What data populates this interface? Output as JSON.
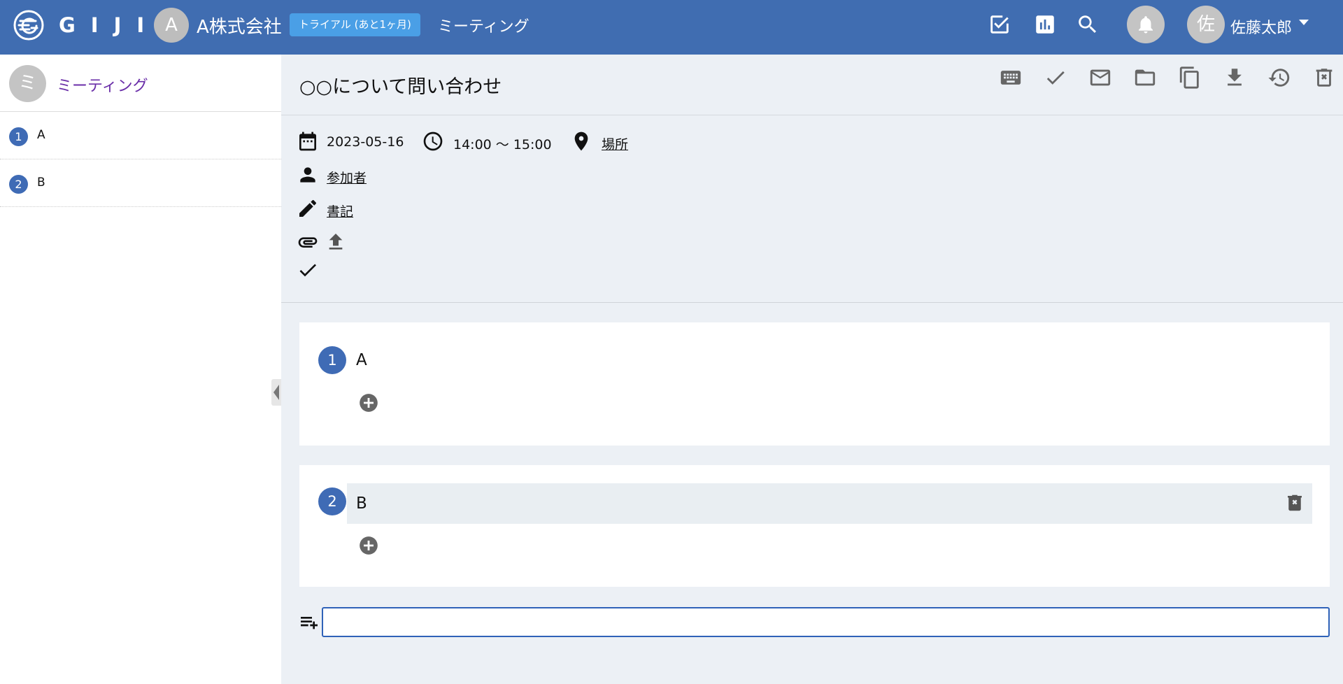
{
  "header": {
    "logo_text": "GIJI",
    "org_avatar": "A",
    "org_name": "A株式会社",
    "trial_badge": "トライアル (あと1ヶ月)",
    "section_title": "ミーティング",
    "user_avatar": "佐",
    "user_name": "佐藤太郎",
    "icons": [
      "task-check-icon",
      "chart-icon",
      "search-icon",
      "bell-icon",
      "caret-down-icon"
    ],
    "brand_color": "#406db1"
  },
  "sidebar": {
    "avatar": "ミ",
    "title": "ミーティング",
    "items": [
      {
        "num": "1",
        "label": "A"
      },
      {
        "num": "2",
        "label": "B"
      }
    ]
  },
  "main": {
    "title": "○○について問い合わせ",
    "toolbar_icons": [
      "keyboard-icon",
      "check-icon",
      "mail-icon",
      "folder-icon",
      "copy-icon",
      "download-icon",
      "history-icon",
      "delete-icon"
    ],
    "meta": {
      "date": "2023-05-16",
      "time": "14:00 〜 15:00",
      "location": "場所",
      "participants": "参加者",
      "secretary": "書記"
    },
    "agenda": [
      {
        "num": "1",
        "title": "A",
        "highlighted": false
      },
      {
        "num": "2",
        "title": "B",
        "highlighted": true
      }
    ],
    "new_item": {
      "value": "",
      "placeholder": ""
    }
  }
}
